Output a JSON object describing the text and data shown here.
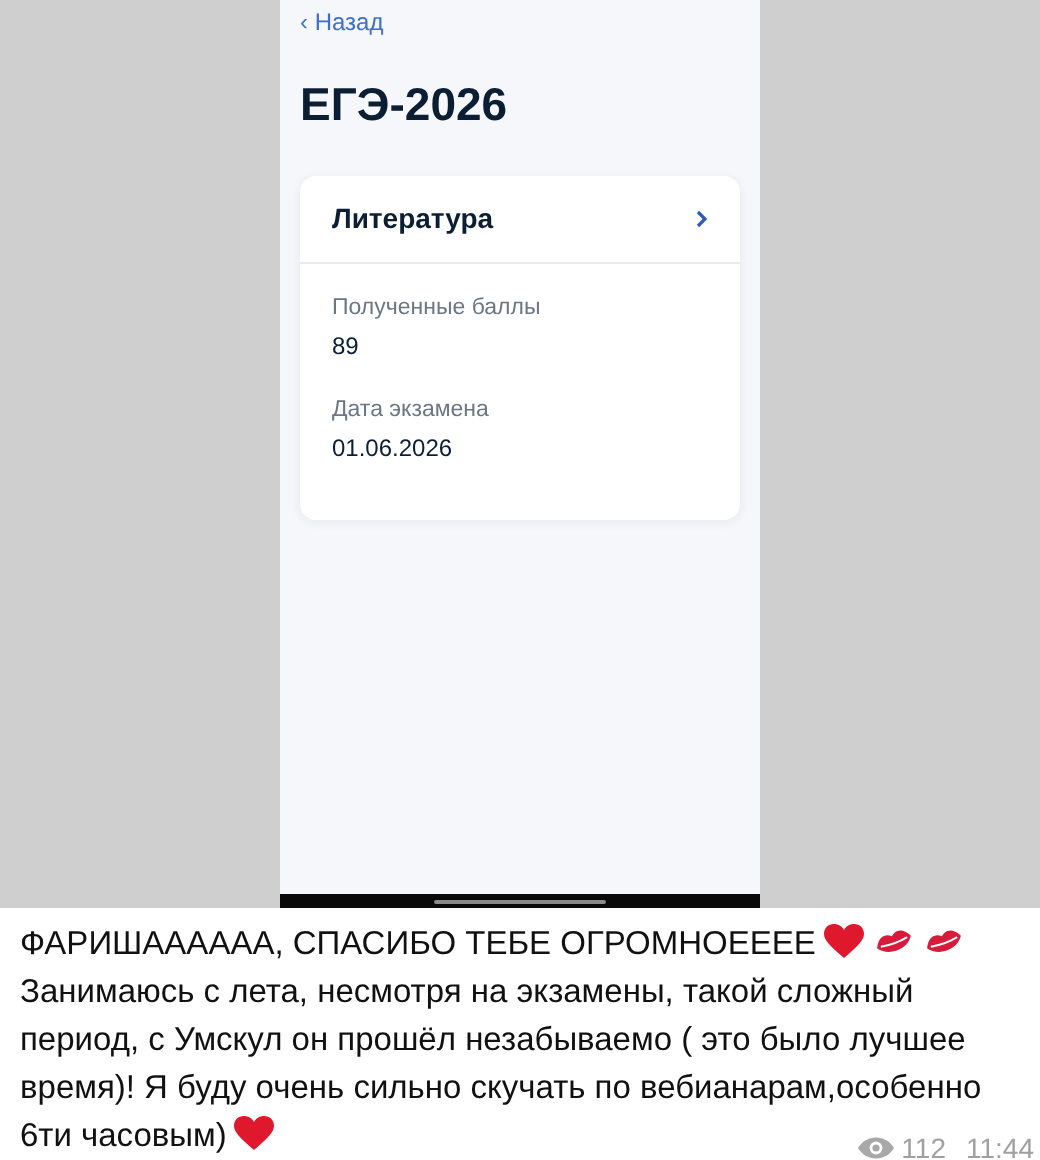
{
  "phone": {
    "back_link": "‹ Назад",
    "title": "ЕГЭ-2026",
    "card": {
      "subject": "Литература",
      "fields": [
        {
          "label": "Полученные баллы",
          "value": "89"
        },
        {
          "label": "Дата экзамена",
          "value": "01.06.2026"
        }
      ]
    }
  },
  "message": {
    "headline": "ФАРИШАААААА, СПАСИБО ТЕБЕ ОГРОМНОЕЕЕЕ",
    "body_lines": [
      "Занимаюсь с лета, несмотря на экзамены, такой сложный",
      "период, с Умскул он прошёл незабываемо ( это было лучшее",
      "время)! Я буду очень сильно скучать по вебианарам,особенно",
      "6ти часовым)"
    ],
    "views": "112",
    "time": "11:44"
  }
}
